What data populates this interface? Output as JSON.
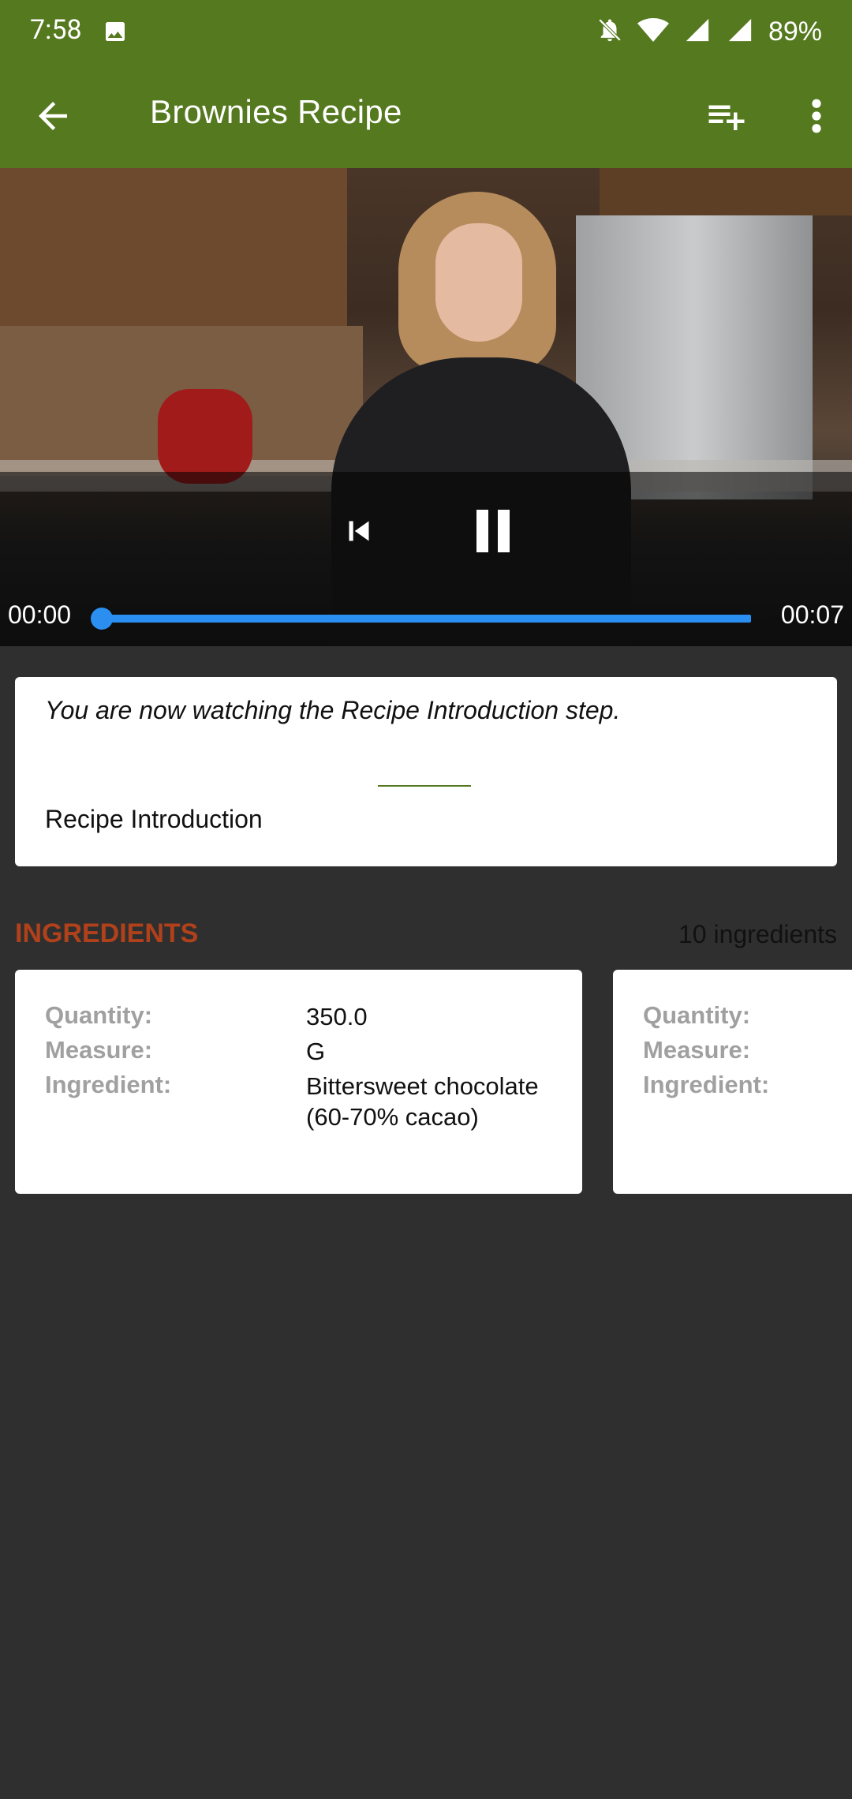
{
  "status_bar": {
    "time": "7:58",
    "battery": "89%",
    "icons": [
      "image-icon",
      "mute-icon",
      "wifi-icon",
      "signal-icon",
      "signal-icon-2"
    ]
  },
  "app_bar": {
    "title": "Brownies Recipe",
    "actions": [
      "back-arrow-icon",
      "playlist-add-icon",
      "more-vert-icon"
    ]
  },
  "player": {
    "current_time": "00:00",
    "duration": "00:07",
    "progress": 0
  },
  "step": {
    "message": "You are now watching the Recipe Introduction step.",
    "name": "Recipe Introduction"
  },
  "ingredients": {
    "title": "INGREDIENTS",
    "count": "10 ingredients",
    "labels": {
      "quantity": "Quantity:",
      "measure": "Measure:",
      "ingredient": "Ingredient:"
    },
    "items": [
      {
        "quantity": "350.0",
        "measure": "G",
        "ingredient": "Bittersweet chocolate (60-70% cacao)"
      }
    ]
  },
  "colors": {
    "primary": "#55791f",
    "accent_title": "#b0411a",
    "progress": "#2a8ff0",
    "background": "#2f2f2f"
  }
}
